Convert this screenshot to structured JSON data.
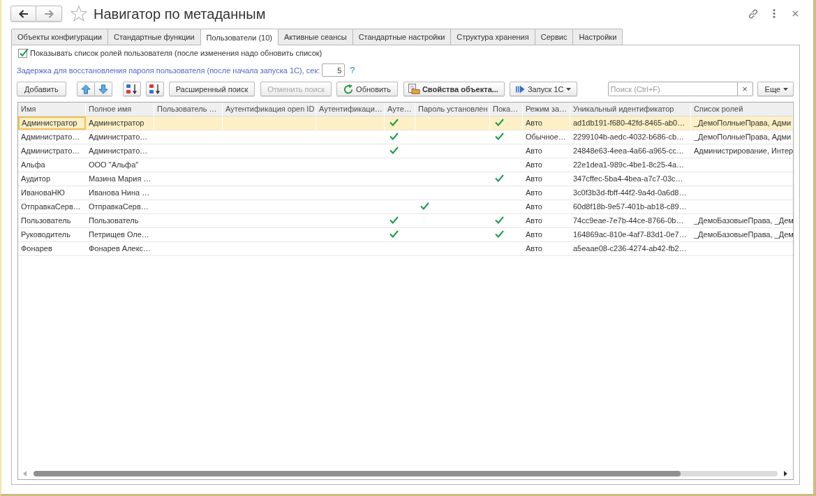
{
  "window": {
    "title": "Навигатор по метаданным"
  },
  "navigation": [
    {
      "kind": "back",
      "disabled": false
    },
    {
      "kind": "forward",
      "disabled": true
    }
  ],
  "tabs": [
    {
      "label": "Объекты конфигурации",
      "selected": false
    },
    {
      "label": "Стандартные функции",
      "selected": false
    },
    {
      "label": "Пользователи (10)",
      "selected": true
    },
    {
      "label": "Активные сеансы",
      "selected": false
    },
    {
      "label": "Стандартные настройки",
      "selected": false
    },
    {
      "label": "Структура хранения",
      "selected": false
    },
    {
      "label": "Сервис",
      "selected": false
    },
    {
      "label": "Настройки",
      "selected": false
    }
  ],
  "show_roles": {
    "label": "Показывать список ролей пользователя (после изменения надо обновить список)",
    "checked": true
  },
  "delay": {
    "label": "Задержка для восстановления пароля пользователя (после начала запуска 1С), сек:",
    "value": "5",
    "help": "?"
  },
  "toolbar": [
    {
      "kind": "add",
      "label": "Добавить",
      "disabled": false
    },
    {
      "kind": "move_up",
      "disabled": false
    },
    {
      "kind": "move_down",
      "disabled": false
    },
    {
      "kind": "sort_ascending",
      "disabled": false
    },
    {
      "kind": "sort_descending",
      "disabled": false
    },
    {
      "kind": "advanced_search",
      "label": "Расширенный поиск",
      "disabled": false
    },
    {
      "kind": "cancel_search",
      "label": "Отменить поиск",
      "disabled": true
    },
    {
      "kind": "refresh",
      "label": "Обновить",
      "disabled": false
    },
    {
      "kind": "properties",
      "label": "Свойства объекта...",
      "disabled": false
    },
    {
      "kind": "launch",
      "label": "Запуск 1С",
      "disabled": false
    }
  ],
  "search": {
    "placeholder": "Поиск (Ctrl+F)",
    "clear": "×"
  },
  "more": {
    "label": "Еще"
  },
  "table": {
    "columns": [
      {
        "label": "Имя",
        "kind": "text"
      },
      {
        "label": "Полное имя",
        "kind": "text"
      },
      {
        "label": "Пользователь …",
        "kind": "text"
      },
      {
        "label": "Аутентификация open ID",
        "kind": "text"
      },
      {
        "label": "Аутентификаци…",
        "kind": "text"
      },
      {
        "label": "Ауте…",
        "kind": "check"
      },
      {
        "label": "Пароль установлен",
        "kind": "check"
      },
      {
        "label": "Пока…",
        "kind": "check"
      },
      {
        "label": "Режим за…",
        "kind": "text"
      },
      {
        "label": "Уникальный идентификатор",
        "kind": "text"
      },
      {
        "label": "Список ролей",
        "kind": "text"
      }
    ],
    "rows": [
      {
        "selected": true,
        "cells": [
          "Администратор",
          "Администратор",
          null,
          null,
          null,
          true,
          false,
          true,
          "Авто",
          "ad1db191-f680-42fd-8465-ab0…",
          "_ДемоПолныеПрава, Адми"
        ]
      },
      {
        "selected": false,
        "cells": [
          "Администрато…",
          "Администрато…",
          null,
          null,
          null,
          true,
          false,
          true,
          "Обычное…",
          "2299104b-aedc-4032-b686-cb…",
          "_ДемоПолныеПрава, Адми"
        ]
      },
      {
        "selected": false,
        "cells": [
          "Администрато…",
          "Администрато…",
          null,
          null,
          null,
          true,
          false,
          false,
          "Авто",
          "24848e63-4eea-4a66-a965-cc…",
          "Администрирование, Интер"
        ]
      },
      {
        "selected": false,
        "cells": [
          "Альфа",
          "ООО \"Альфа\"",
          null,
          null,
          null,
          false,
          false,
          false,
          "Авто",
          "22e1dea1-989c-4be1-8c25-4a…",
          null
        ]
      },
      {
        "selected": false,
        "cells": [
          "Аудитор",
          "Мазина Мария …",
          null,
          null,
          null,
          false,
          false,
          true,
          "Авто",
          "347cffec-5ba4-4bea-a7c7-03c…",
          null
        ]
      },
      {
        "selected": false,
        "cells": [
          "ИвановаНЮ",
          "Иванова Нина …",
          null,
          null,
          null,
          false,
          false,
          false,
          "Авто",
          "3c0f3b3d-fbff-44f2-9a4d-0a6d8…",
          null
        ]
      },
      {
        "selected": false,
        "cells": [
          "ОтправкаСерв…",
          "ОтправкаСерв…",
          null,
          null,
          null,
          false,
          true,
          false,
          "Авто",
          "60d8f18b-9e57-401b-ab18-c89…",
          null
        ]
      },
      {
        "selected": false,
        "cells": [
          "Пользователь",
          "Пользователь",
          null,
          null,
          null,
          true,
          false,
          true,
          "Авто",
          "74cc9eae-7e7b-44ce-8766-0b…",
          "_ДемоБазовыеПрава, _Дем"
        ]
      },
      {
        "selected": false,
        "cells": [
          "Руководитель",
          "Петрищев Оле…",
          null,
          null,
          null,
          true,
          false,
          true,
          "Авто",
          "164869ac-810e-4af7-83d1-0e7…",
          "_ДемоБазовыеПрава, _Дем"
        ]
      },
      {
        "selected": false,
        "cells": [
          "Фонарев",
          "Фонарев Алекс…",
          null,
          null,
          null,
          false,
          false,
          false,
          "Авто",
          "a5eaae08-c236-4274-ab42-fb2…",
          null
        ]
      }
    ]
  }
}
